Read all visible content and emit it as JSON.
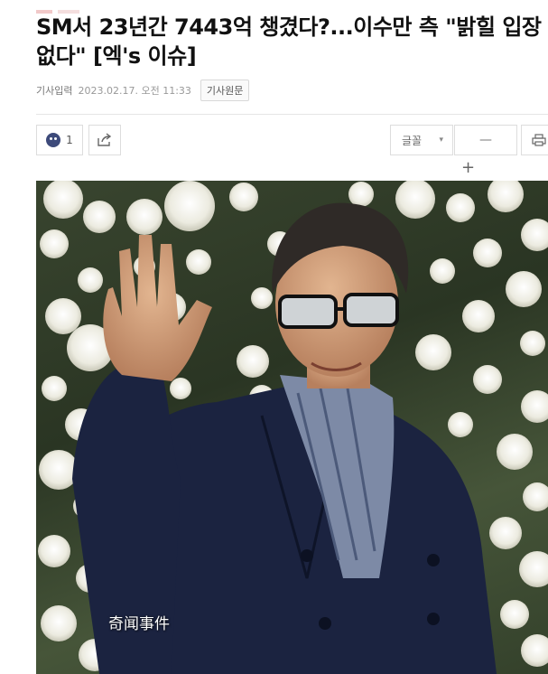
{
  "article": {
    "headline": "SM서 23년간 7443억 챙겼다?...이수만 측 \"밝힐 입장 없다\" [엑's 이슈]",
    "meta_label": "기사입력",
    "published": "2023.02.17. 오전 11:33",
    "original_link_label": "기사원문"
  },
  "toolbar": {
    "reaction_count": "1",
    "font_label": "글꼴",
    "font_caret": "▾",
    "decrease_label": "—",
    "increase_label": "+"
  },
  "photo": {
    "watermark": "奇闻事件"
  },
  "icons": {
    "reaction": "surprised-face-icon",
    "share": "share-icon",
    "print": "print-icon"
  },
  "colors": {
    "reaction_face": "#3d4a7a",
    "jacket": "#1b2340",
    "foliage": "#34412b",
    "flowers": "#f3f2ea"
  }
}
